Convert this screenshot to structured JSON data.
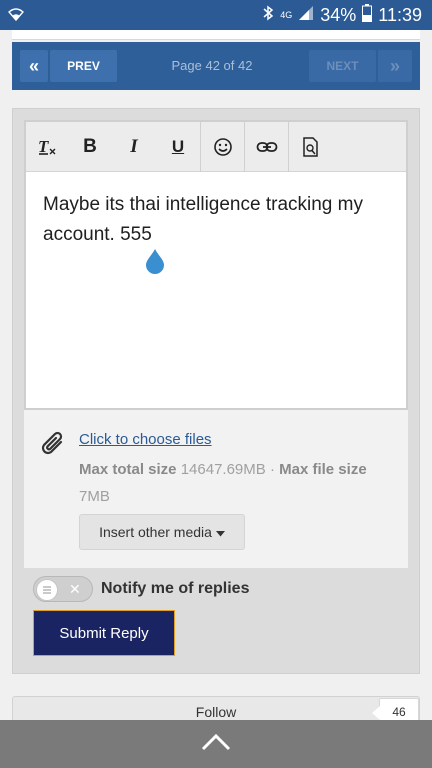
{
  "status_bar": {
    "network": "4G",
    "battery": "34%",
    "time": "11:39"
  },
  "pager": {
    "prev": "PREV",
    "page_label": "Page 42 of 42",
    "next": "NEXT"
  },
  "editor": {
    "toolbar_icons": [
      "clear-format-icon",
      "bold-icon",
      "italic-icon",
      "underline-icon",
      "emoji-icon",
      "link-icon",
      "preview-icon"
    ],
    "bold": "B",
    "italic": "I",
    "underline": "U",
    "content": "Maybe its thai intelligence tracking my account. 555"
  },
  "attachments": {
    "choose_files": "Click to choose files",
    "max_total_label": "Max total size",
    "max_total_value": "14647.69MB",
    "separator": "·",
    "max_file_label": "Max file size",
    "max_file_value": "7MB",
    "insert_media": "Insert other media"
  },
  "notify": {
    "label": "Notify me of replies",
    "enabled": false
  },
  "submit": "Submit Reply",
  "follow": {
    "label": "Follow",
    "count": "46"
  },
  "colors": {
    "status_bar": "#2b5a94",
    "pager": "#2e5f99",
    "submit_bg": "#1a2462",
    "submit_border": "#e0a028",
    "link": "#2b5a94",
    "drop": "#3a8fd0"
  }
}
